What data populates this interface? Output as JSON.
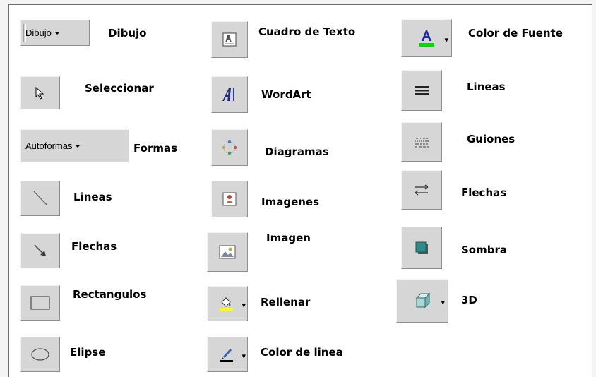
{
  "buttons": {
    "dibujo": {
      "pre": "Di",
      "ul": "b",
      "post": "ujo"
    },
    "autoformas": {
      "pre": "A",
      "ul": "u",
      "post": "toformas"
    }
  },
  "col1": {
    "dibujo": "Dibujo",
    "seleccionar": "Seleccionar",
    "formas": "Formas",
    "lineas": "Lineas",
    "flechas": "Flechas",
    "rectangulos": "Rectangulos",
    "elipse": "Elipse"
  },
  "col2": {
    "cuadro": "Cuadro de Texto",
    "wordart": "WordArt",
    "diagramas": "Diagramas",
    "imagenes": "Imagenes",
    "imagen": "Imagen",
    "rellenar": "Rellenar",
    "colorlinea": "Color de linea"
  },
  "col3": {
    "colorfuente": "Color de Fuente",
    "lineas": "Lineas",
    "guiones": "Guiones",
    "flechas": "Flechas",
    "sombra": "Sombra",
    "tresd": "3D"
  },
  "colors": {
    "fontcolor_bar": "#00dd00",
    "fill_bar": "#ffff00",
    "line_bar": "#000000",
    "shadow_fill": "#2e8b8b",
    "wordart": "#1e2a8c",
    "button_face": "#d6d6d6"
  },
  "icons": [
    "select-arrow-icon",
    "line-icon",
    "arrow-icon",
    "rectangle-icon",
    "ellipse-icon",
    "textbox-icon",
    "wordart-icon",
    "diagram-icon",
    "clipart-icon",
    "picture-icon",
    "fill-color-icon",
    "line-color-icon",
    "font-color-icon",
    "line-style-icon",
    "dash-style-icon",
    "arrow-style-icon",
    "shadow-icon",
    "3d-icon"
  ]
}
